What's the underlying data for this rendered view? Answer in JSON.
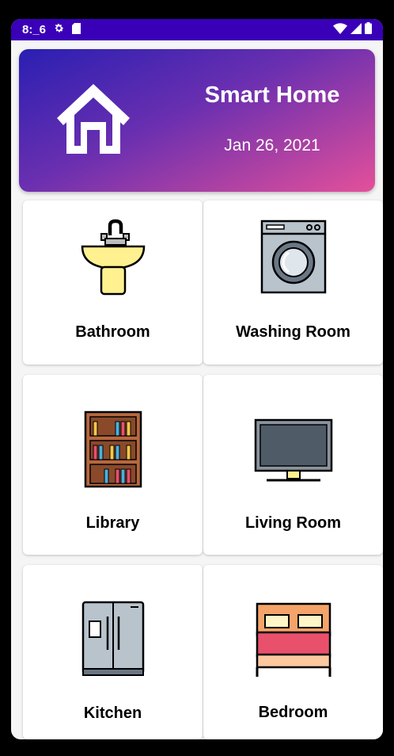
{
  "status_bar": {
    "time": "8:_6"
  },
  "header": {
    "title": "Smart Home",
    "date": "Jan 26, 2021"
  },
  "rooms": [
    {
      "label": "Bathroom",
      "icon": "sink-icon"
    },
    {
      "label": "Washing Room",
      "icon": "washing-machine-icon"
    },
    {
      "label": "Library",
      "icon": "bookshelf-icon"
    },
    {
      "label": "Living Room",
      "icon": "tv-icon"
    },
    {
      "label": "Kitchen",
      "icon": "refrigerator-icon"
    },
    {
      "label": "Bedroom",
      "icon": "bed-icon"
    }
  ],
  "colors": {
    "status_bar": "#3a00b8",
    "header_gradient_start": "#2a1fb2",
    "header_gradient_end": "#e4509a"
  }
}
